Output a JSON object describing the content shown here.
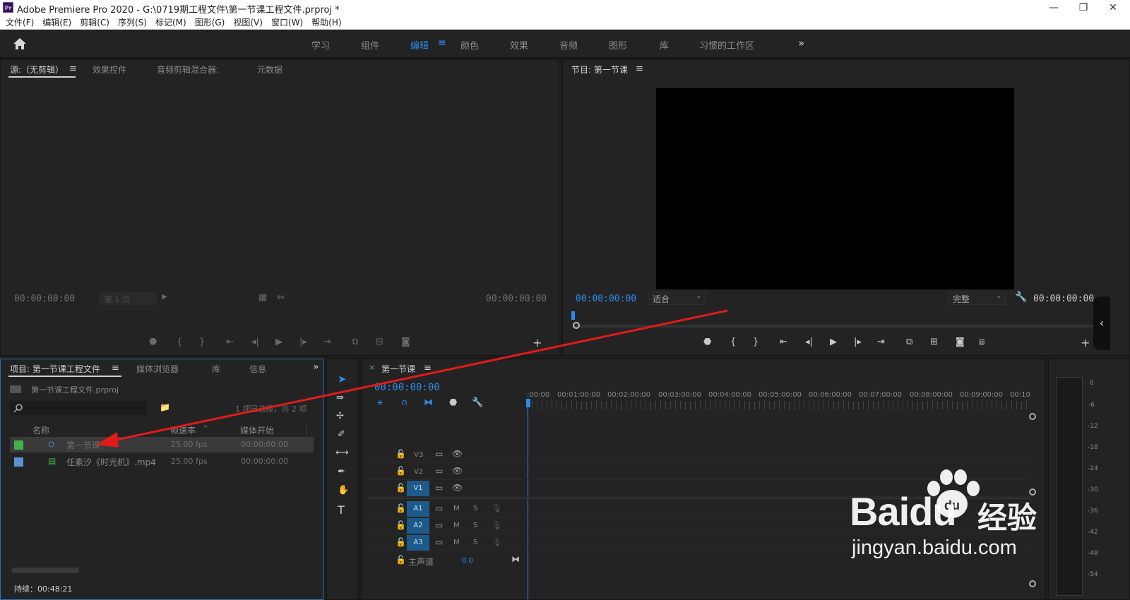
{
  "window": {
    "app_icon": "Pr",
    "title": "Adobe Premiere Pro 2020 - G:\\0719期工程文件\\第一节课工程文件.prproj *",
    "minimize": "—",
    "restore": "❐",
    "close": "✕"
  },
  "menu": [
    "文件(F)",
    "编辑(E)",
    "剪辑(C)",
    "序列(S)",
    "标记(M)",
    "图形(G)",
    "视图(V)",
    "窗口(W)",
    "帮助(H)"
  ],
  "workspaces": [
    "学习",
    "组件",
    "编辑",
    "颜色",
    "效果",
    "音频",
    "图形",
    "库",
    "习惯的工作区"
  ],
  "workspace_active": "编辑",
  "workspace_more": "»",
  "source_panel": {
    "tabs": [
      "源:（无剪辑）",
      "效果控件",
      "音频剪辑混合器:",
      "元数据"
    ],
    "timecode_left": "00:00:00:00",
    "page": "第 1 页",
    "timecode_right": "00:00:00:00"
  },
  "program_panel": {
    "title": "节目: 第一节课",
    "timecode_left": "00:00:00:00",
    "fit": "适合",
    "quality": "完整",
    "timecode_right": "00:00:00:00"
  },
  "project_panel": {
    "tabs": [
      "项目: 第一节课工程文件",
      "媒体浏览器",
      "库",
      "信息"
    ],
    "more": "»",
    "file": "第一节课工程文件.prproj",
    "selection_status": "1 项已选择，共 2 项",
    "columns": [
      "名称",
      "帧速率",
      "媒体开始"
    ],
    "items": [
      {
        "name": "第一节课",
        "fps": "25.00 fps",
        "start": "00:00:00:00",
        "color": "#3fb24a"
      },
      {
        "name": "任素汐《时光机》.mp4",
        "fps": "25.00 fps",
        "start": "00:00:00:00",
        "color": "#5b8fd6"
      }
    ],
    "footer": "持续：00:48:21"
  },
  "timeline": {
    "tab": "第一节课",
    "timecode": "00:00:00:00",
    "ruler": [
      ":00:00",
      "00:01:00:00",
      "00:02:00:00",
      "00:03:00:00",
      "00:04:00:00",
      "00:05:00:00",
      "00:06:00:00",
      "00:07:00:00",
      "00:08:00:00",
      "00:09:00:00",
      "00:10"
    ],
    "video_tracks": [
      "V3",
      "V2",
      "V1"
    ],
    "audio_tracks": [
      "A1",
      "A2",
      "A3"
    ],
    "master": "主声道",
    "master_value": "0.0",
    "mute": "M",
    "solo": "S"
  },
  "meter": {
    "scale": [
      "0",
      "-6",
      "-12",
      "-18",
      "-24",
      "-30",
      "-36",
      "-42",
      "-48",
      "-54"
    ]
  },
  "watermark": {
    "brand": "Baidu",
    "cn": "经验",
    "url": "jingyan.baidu.com"
  },
  "colors": {
    "accent": "#2d8ceb",
    "arrow": "#e01b1b",
    "track_target": "#1d5a8a"
  }
}
